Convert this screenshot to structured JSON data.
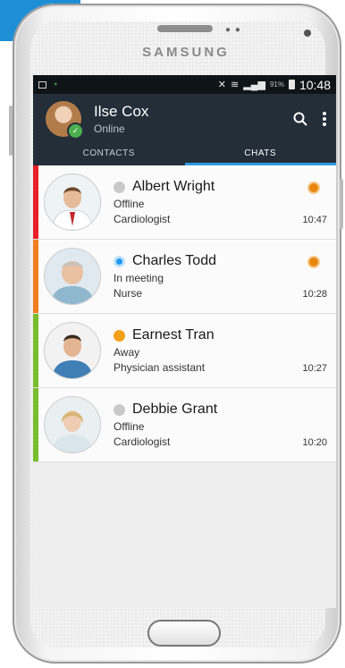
{
  "device": {
    "brand": "SAMSUNG"
  },
  "status_bar": {
    "battery": "91%",
    "time": "10:48"
  },
  "user": {
    "name": "Ilse Cox",
    "presence": "Online"
  },
  "tabs": [
    {
      "label": "CONTACTS",
      "active": false
    },
    {
      "label": "CHATS",
      "active": true
    }
  ],
  "chats": [
    {
      "name": "Albert Wright",
      "status": "Offline",
      "role": "Cardiologist",
      "time": "10:47",
      "presence": "offline",
      "bar_color": "#e8202a",
      "unread": true
    },
    {
      "name": "Charles Todd",
      "status": "In meeting",
      "role": "Nurse",
      "time": "10:28",
      "presence": "meeting",
      "bar_color": "#f07f1f",
      "unread": true
    },
    {
      "name": "Earnest Tran",
      "status": "Away",
      "role": "Physician assistant",
      "time": "10:27",
      "presence": "away",
      "bar_color": "#79be2e",
      "unread": false
    },
    {
      "name": "Debbie Grant",
      "status": "Offline",
      "role": "Cardiologist",
      "time": "10:20",
      "presence": "offline",
      "bar_color": "#79be2e",
      "unread": false
    }
  ],
  "colors": {
    "header_bg": "#232e38",
    "tab_indicator": "#2f9be0",
    "online_green": "#4caf50",
    "unread_orange": "#e8860f"
  },
  "icons": {
    "search": "search-icon",
    "menu": "more-vert-icon"
  }
}
